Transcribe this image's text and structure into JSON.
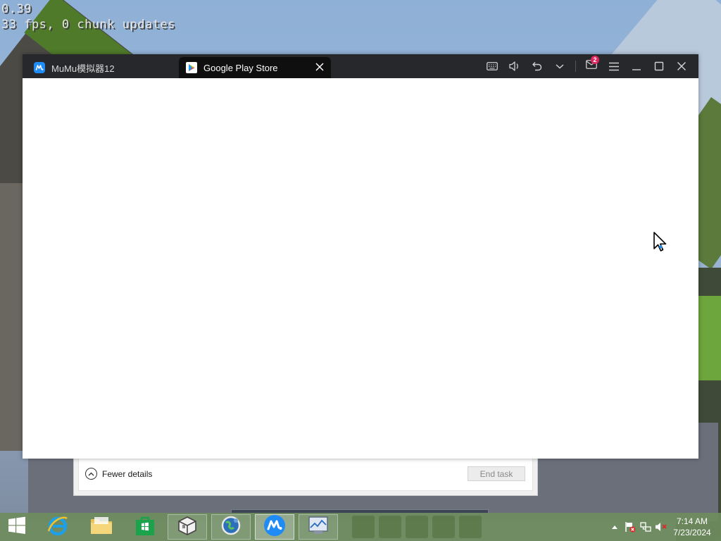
{
  "hud": {
    "line1": "0.39",
    "line2": "33 fps, 0 chunk updates"
  },
  "emulator": {
    "tabs": [
      {
        "label": "MuMu模拟器12",
        "icon": "mumu-logo-icon"
      },
      {
        "label": "Google Play Store",
        "icon": "google-play-icon"
      }
    ],
    "toolbar": {
      "keyboard": "keyboard-icon",
      "volume": "volume-icon",
      "back": "back-icon",
      "more": "chevron-down-icon",
      "mail": "mail-icon",
      "mail_badge": "2",
      "menu": "menu-icon",
      "minimize": "minimize-icon",
      "maximize": "maximize-icon",
      "close": "close-icon"
    }
  },
  "task_manager": {
    "fewer_details_label": "Fewer details",
    "end_task_label": "End task"
  },
  "taskbar": {
    "pinned": [
      {
        "name": "start-button",
        "icon": "windows-logo-icon"
      },
      {
        "name": "internet-explorer",
        "icon": "internet-explorer-icon"
      },
      {
        "name": "file-explorer",
        "icon": "folder-icon"
      },
      {
        "name": "store",
        "icon": "store-icon"
      },
      {
        "name": "app-cube",
        "icon": "cube-icon"
      },
      {
        "name": "app-globe",
        "icon": "globe-icon"
      },
      {
        "name": "mumu-emulator",
        "icon": "mumu-logo-icon"
      },
      {
        "name": "task-manager",
        "icon": "task-manager-icon"
      }
    ],
    "clock": {
      "time": "7:14 AM",
      "date": "7/23/2024"
    }
  },
  "colors": {
    "titlebar": "#27282b",
    "active_tab": "#0f0f10",
    "badge": "#e0245e",
    "mumu_blue": "#1f8bf5",
    "taskbar": "#6e8c5f"
  }
}
